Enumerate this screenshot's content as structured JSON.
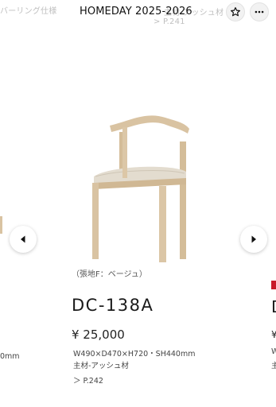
{
  "header": {
    "ghost_left": "バーリング仕様",
    "ghost_right_1": "主材-アッシュ材",
    "ghost_right_2": "> P.241",
    "title": "HOMEDAY 2025-2026",
    "star_icon": "star-outline-icon",
    "more_icon": "more-horizontal-icon"
  },
  "carousel": {
    "prev_icon": "chevron-left-icon",
    "next_icon": "chevron-right-icon",
    "left_edge_text": "0mm",
    "right_edge_letter": "D",
    "right_edge_price": "¥",
    "right_edge_line1": "W",
    "right_edge_line2": "主"
  },
  "product": {
    "image": "chair-icon",
    "material_note": "（張地F：ベージュ）",
    "code": "DC-138A",
    "price": "¥ 25,000",
    "dimensions": "W490×D470×H720・SH440mm",
    "main_material": "主材-アッシュ材",
    "page_ref": "＞ P.242"
  },
  "colors": {
    "wood": "#d9c3a2",
    "seat": "#dcd4c8",
    "accent_red": "#c9192a"
  }
}
